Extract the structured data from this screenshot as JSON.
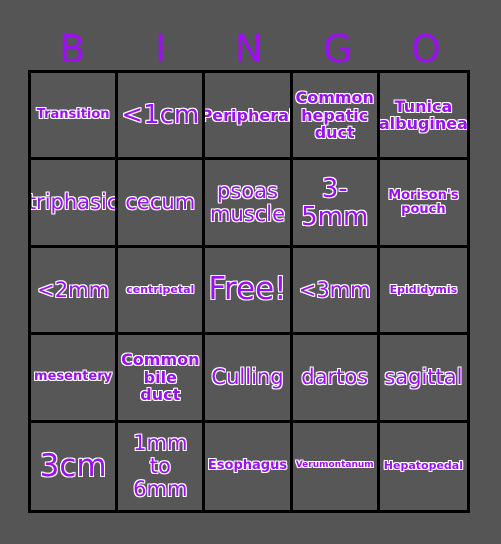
{
  "header": {
    "letters": [
      "B",
      "I",
      "N",
      "G",
      "O"
    ]
  },
  "colors": {
    "text_purple": "#9b0ff0",
    "text_outline": "#ffffff",
    "page_background": "#555555",
    "cell_background": "#575757",
    "grid_line": "#000000"
  },
  "grid": {
    "columns": 5,
    "rows": 5,
    "free_space": "Free!",
    "cells": [
      [
        {
          "label": "Transition",
          "size": "sm"
        },
        {
          "label": "<1cm",
          "size": "xl"
        },
        {
          "label": "Peripheral",
          "size": "md"
        },
        {
          "label": "Common hepatic duct",
          "size": "md"
        },
        {
          "label": "Tunica albuginea",
          "size": "md"
        }
      ],
      [
        {
          "label": "triphasic",
          "size": "lg"
        },
        {
          "label": "cecum",
          "size": "lg"
        },
        {
          "label": "psoas muscle",
          "size": "lg"
        },
        {
          "label": "3- 5mm",
          "size": "xl"
        },
        {
          "label": "Morison's pouch",
          "size": "sm"
        }
      ],
      [
        {
          "label": "<2mm",
          "size": "lg"
        },
        {
          "label": "centripetal",
          "size": "xs"
        },
        {
          "label": "Free!",
          "size": "xxl"
        },
        {
          "label": "<3mm",
          "size": "lg"
        },
        {
          "label": "Epididymis",
          "size": "xs"
        }
      ],
      [
        {
          "label": "mesentery",
          "size": "sm"
        },
        {
          "label": "Common bile duct",
          "size": "md"
        },
        {
          "label": "Culling",
          "size": "lg"
        },
        {
          "label": "dartos",
          "size": "lg"
        },
        {
          "label": "sagittal",
          "size": "lg"
        }
      ],
      [
        {
          "label": "3cm",
          "size": "xxl"
        },
        {
          "label": "1mm to 6mm",
          "size": "lg"
        },
        {
          "label": "Esophagus",
          "size": "sm"
        },
        {
          "label": "Verumontanum",
          "size": "xxs"
        },
        {
          "label": "Hepatopedal",
          "size": "xs"
        }
      ]
    ]
  }
}
